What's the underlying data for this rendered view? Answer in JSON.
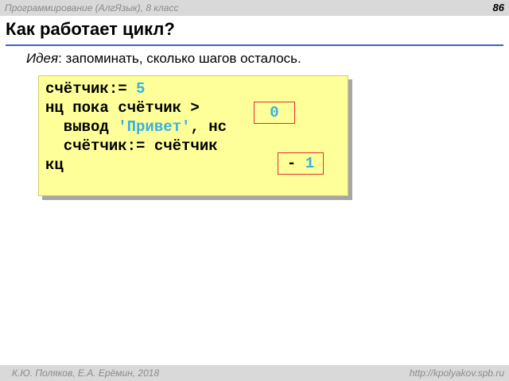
{
  "header": {
    "course": "Программирование (АлгЯзык), 8 класс",
    "page_number": "86"
  },
  "slide": {
    "title": "Как работает цикл?",
    "idea_label": "Идея",
    "idea_text": ": запоминать, сколько шагов осталось."
  },
  "code": {
    "line1_prefix": "счётчик:= ",
    "line1_value": "5",
    "line2": "нц пока счётчик >",
    "line3_prefix": "  вывод ",
    "line3_string": "'Привет'",
    "line3_suffix": ", нс",
    "line4": "  счётчик:= счётчик",
    "line5": "кц",
    "box1_value": "0",
    "box2_op": "- ",
    "box2_value": "1"
  },
  "footer": {
    "author": "К.Ю. Поляков, Е.А. Ерёмин, 2018",
    "url": "http://kpolyakov.spb.ru"
  },
  "colors": {
    "accent_rule": "#3a64c8",
    "code_bg": "#ffff99",
    "highlight": "#33b3e0",
    "box_border": "#e23030"
  }
}
